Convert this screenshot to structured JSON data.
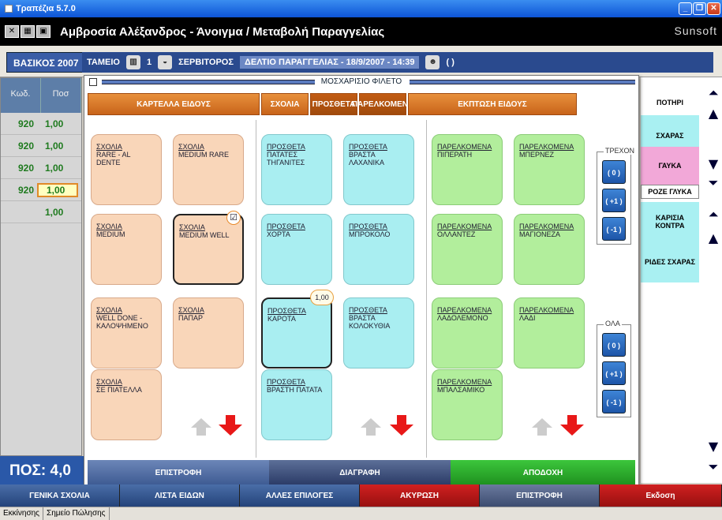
{
  "window": {
    "title": "Τραπέζια 5.7.0"
  },
  "header": {
    "title": "Αμβροσία Αλέξανδρος - Άνοιγμα / Μεταβολή Παραγγελίας",
    "brand": "Sunsoft"
  },
  "info": {
    "year": "ΒΑΣΙΚΟΣ 2007",
    "cashier_label": "ΤΑΜΕΙΟ",
    "cashier_no": "1",
    "waiter_label": "ΣΕΡΒΙΤΟΡΟΣ",
    "deltio": "ΔΕΛΤΙΟ ΠΑΡΑΓΓΕΛΙΑΣ - 18/9/2007 - 14:39",
    "user": "( )"
  },
  "left_table": {
    "headers": [
      "Κωδ.",
      "Ποσ"
    ],
    "rows": [
      {
        "code": "920",
        "qty": "1,00"
      },
      {
        "code": "920",
        "qty": "1,00"
      },
      {
        "code": "920",
        "qty": "1,00"
      },
      {
        "code": "920",
        "qty": "1,00"
      },
      {
        "code": "",
        "qty": "1,00"
      }
    ],
    "total_label": "ΠΟΣ:",
    "total_value": "4,0"
  },
  "right_panel": {
    "items": [
      "ΠΟΤΗΡΙ",
      "ΣΧΑΡΑΣ",
      "ΓΑΥΚΑ",
      "ΡΟΖΕ ΓΛΥΚΑ",
      "ΚΑΡΙΣΙΑ ΚΟΝΤΡΑ",
      "ΡΙΔΕΣ ΣΧΑΡΑΣ"
    ]
  },
  "dialog": {
    "title": "ΜΟΣΧΑΡΙΣΙΟ ΦΙΛΕΤΟ",
    "tabs": [
      "ΚΑΡΤΕΛΛΑ ΕΙΔΟΥΣ",
      "ΣΧΟΛΙΑ",
      "ΠΡΟΣΘΕΤΑ",
      "ΠΑΡΕΛΚΟΜΕΝΑ",
      "ΕΚΠΤΩΣΗ ΕΙΔΟΥΣ"
    ],
    "scholia": [
      {
        "cat": "ΣΧΟΛΙΑ",
        "name": "RARE - AL DENTE"
      },
      {
        "cat": "ΣΧΟΛΙΑ",
        "name": "MEDIUM RARE"
      },
      {
        "cat": "ΣΧΟΛΙΑ",
        "name": "MEDIUM"
      },
      {
        "cat": "ΣΧΟΛΙΑ",
        "name": "MEDIUM WELL"
      },
      {
        "cat": "ΣΧΟΛΙΑ",
        "name": "WELL DONE - ΚΑΛΟΨΗΜΕΝΟ"
      },
      {
        "cat": "ΣΧΟΛΙΑ",
        "name": "ΠΑΠΑΡ"
      },
      {
        "cat": "ΣΧΟΛΙΑ",
        "name": "ΣΕ ΠΙΑΤΕΛΛΑ"
      }
    ],
    "prostheta": [
      {
        "cat": "ΠΡΟΣΘΕΤΑ",
        "name": "ΠΑΤΑΤΕΣ ΤΗΓΑΝΙΤΕΣ"
      },
      {
        "cat": "ΠΡΟΣΘΕΤΑ",
        "name": "ΒΡΑΣΤΑ ΛΑΧΑΝΙΚΑ"
      },
      {
        "cat": "ΠΡΟΣΘΕΤΑ",
        "name": "ΧΟΡΤΑ"
      },
      {
        "cat": "ΠΡΟΣΘΕΤΑ",
        "name": "ΜΠΡΟΚΟΛΟ"
      },
      {
        "cat": "ΠΡΟΣΘΕΤΑ",
        "name": "ΚΑΡΟΤΑ"
      },
      {
        "cat": "ΠΡΟΣΘΕΤΑ",
        "name": "ΒΡΑΣΤΑ ΚΟΛΟΚΥΘΙΑ"
      },
      {
        "cat": "ΠΡΟΣΘΕΤΑ",
        "name": "ΒΡΑΣΤΗ ΠΑΤΑΤΑ"
      }
    ],
    "parelkomena": [
      {
        "cat": "ΠΑΡΕΛΚΟΜΕΝΑ",
        "name": "ΠΙΠΕΡΑΤΗ"
      },
      {
        "cat": "ΠΑΡΕΛΚΟΜΕΝΑ",
        "name": "ΜΠΕΡΝΕΖ"
      },
      {
        "cat": "ΠΑΡΕΛΚΟΜΕΝΑ",
        "name": "ΟΛΛΑΝΤΕΖ"
      },
      {
        "cat": "ΠΑΡΕΛΚΟΜΕΝΑ",
        "name": "ΜΑΓΙΟΝΕΖΑ"
      },
      {
        "cat": "ΠΑΡΕΛΚΟΜΕΝΑ",
        "name": "ΛΑΔΟΛΕΜΟΝΟ"
      },
      {
        "cat": "ΠΑΡΕΛΚΟΜΕΝΑ",
        "name": "ΛΑΔΙ"
      },
      {
        "cat": "ΠΑΡΕΛΚΟΜΕΝΑ",
        "name": "ΜΠΑΛΣΑΜΙΚΟ"
      }
    ],
    "badge": "1,00",
    "current_label": "ΤΡΕΧΟΝ",
    "all_label": "ΟΛΑ",
    "qty_buttons": [
      "( 0 )",
      "( +1 )",
      "( -1 )"
    ],
    "footer": [
      "ΕΠΙΣΤΡΟΦΗ",
      "ΔΙΑΓΡΑΦΗ",
      "ΑΠΟΔΟΧΗ"
    ]
  },
  "bottom_buttons": [
    "ΓΕΝΙΚΑ ΣΧΟΛΙΑ",
    "ΛΙΣΤΑ ΕΙΔΩΝ",
    "ΑΛΛΕΣ ΕΠΙΛΟΓΕΣ",
    "ΑΚΥΡΩΣΗ",
    "ΕΠΙΣΤΡΟΦΗ",
    "Εκδοση"
  ],
  "status_tabs": [
    "Εκκίνησης",
    "Σημείο Πώλησης"
  ],
  "colors": {
    "scholia": "#f9d6b9",
    "prostheta": "#a9eef1",
    "parelkomena": "#b2ee9c",
    "accept": "#2ba82b",
    "cancel": "#b81414"
  }
}
